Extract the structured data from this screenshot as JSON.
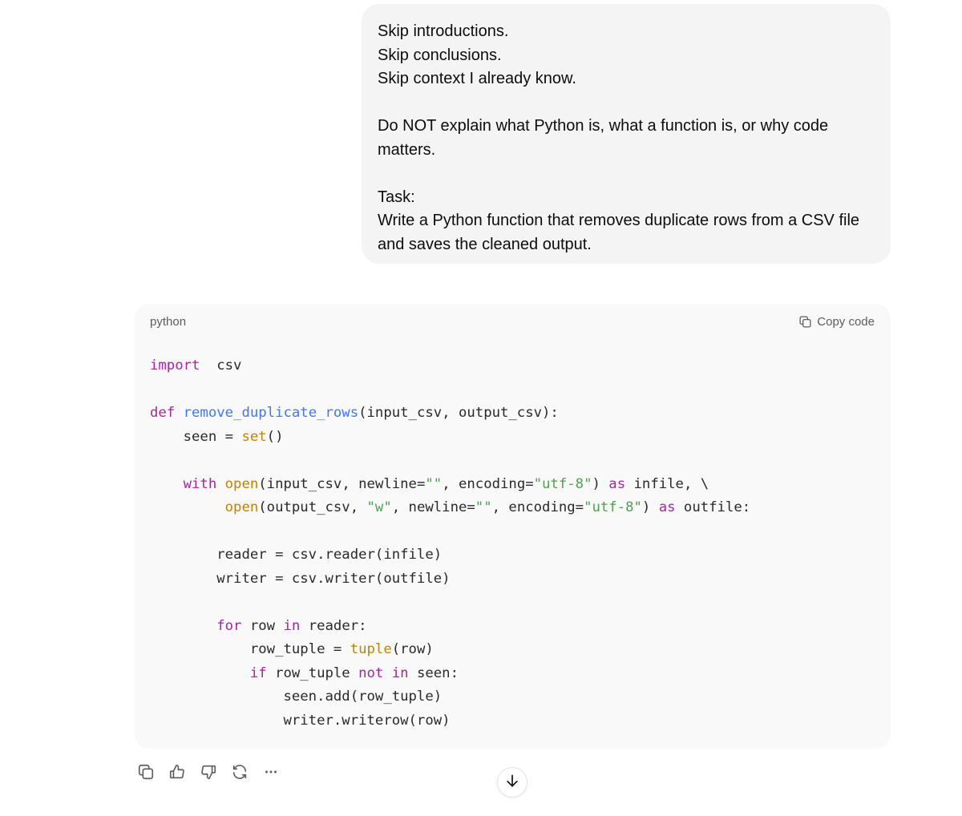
{
  "user_message": {
    "lines": [
      "Skip introductions.",
      "Skip conclusions.",
      "Skip context I already know.",
      "",
      "Do NOT explain what Python is, what a function is, or why code",
      "matters.",
      "",
      "Task:",
      "Write a Python function that removes duplicate rows from a CSV file",
      "and saves the cleaned output."
    ]
  },
  "code_block": {
    "language": "python",
    "copy_label": "Copy code",
    "lines": [
      [
        [
          "kw",
          "import"
        ],
        [
          "",
          "  csv"
        ]
      ],
      [],
      [
        [
          "kw",
          "def"
        ],
        [
          "",
          " "
        ],
        [
          "fn",
          "remove_duplicate_rows"
        ],
        [
          "",
          "(input_csv, output_csv):"
        ]
      ],
      [
        [
          "",
          "    seen = "
        ],
        [
          "bi",
          "set"
        ],
        [
          "",
          "()"
        ]
      ],
      [],
      [
        [
          "",
          "    "
        ],
        [
          "kw",
          "with"
        ],
        [
          "",
          " "
        ],
        [
          "bi",
          "open"
        ],
        [
          "",
          "(input_csv, newline="
        ],
        [
          "str",
          "\"\""
        ],
        [
          "",
          ", encoding="
        ],
        [
          "str",
          "\"utf-8\""
        ],
        [
          "",
          ") "
        ],
        [
          "kw",
          "as"
        ],
        [
          "",
          " infile, \\"
        ]
      ],
      [
        [
          "",
          "         "
        ],
        [
          "bi",
          "open"
        ],
        [
          "",
          "(output_csv, "
        ],
        [
          "str",
          "\"w\""
        ],
        [
          "",
          ", newline="
        ],
        [
          "str",
          "\"\""
        ],
        [
          "",
          ", encoding="
        ],
        [
          "str",
          "\"utf-8\""
        ],
        [
          "",
          ") "
        ],
        [
          "kw",
          "as"
        ],
        [
          "",
          " outfile:"
        ]
      ],
      [],
      [
        [
          "",
          "        reader = csv.reader(infile)"
        ]
      ],
      [
        [
          "",
          "        writer = csv.writer(outfile)"
        ]
      ],
      [],
      [
        [
          "",
          "        "
        ],
        [
          "kw",
          "for"
        ],
        [
          "",
          " row "
        ],
        [
          "kw",
          "in"
        ],
        [
          "",
          " reader:"
        ]
      ],
      [
        [
          "",
          "            row_tuple = "
        ],
        [
          "bi",
          "tuple"
        ],
        [
          "",
          "(row)"
        ]
      ],
      [
        [
          "",
          "            "
        ],
        [
          "kw",
          "if"
        ],
        [
          "",
          " row_tuple "
        ],
        [
          "kw",
          "not"
        ],
        [
          "",
          " "
        ],
        [
          "kw",
          "in"
        ],
        [
          "",
          " seen:"
        ]
      ],
      [
        [
          "",
          "                seen.add(row_tuple)"
        ]
      ],
      [
        [
          "",
          "                writer.writerow(row)"
        ]
      ]
    ]
  },
  "actions": [
    {
      "name": "copy-response-button",
      "icon": "copy-icon"
    },
    {
      "name": "thumbs-up-button",
      "icon": "thumbs-up-icon"
    },
    {
      "name": "thumbs-down-button",
      "icon": "thumbs-down-icon"
    },
    {
      "name": "regenerate-button",
      "icon": "refresh-icon"
    },
    {
      "name": "more-options-button",
      "icon": "more-horizontal-icon"
    }
  ],
  "scroll_button": {
    "icon": "arrow-down-icon"
  },
  "colors": {
    "keyword": "#a626a4",
    "function": "#4078f2",
    "builtin": "#c18401",
    "string": "#50a14f",
    "bubble_bg": "#f4f4f4",
    "code_bg": "#f9f9f9"
  }
}
